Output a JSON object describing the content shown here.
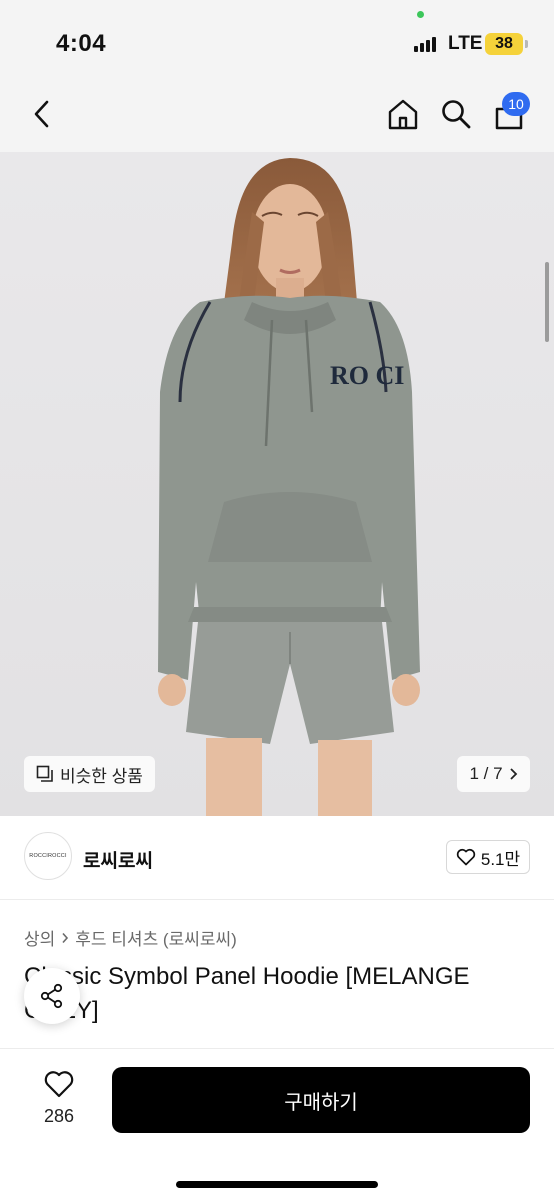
{
  "status_bar": {
    "time": "4:04",
    "network": "LTE",
    "battery": "38",
    "battery_color": "#f5d23a"
  },
  "nav": {
    "cart_count": "10",
    "badge_color": "#2f6bf0"
  },
  "hero": {
    "logo_text": "RO CI",
    "similar_label": "비슷한 상품",
    "counter": "1 / 7"
  },
  "shop": {
    "logo_text": "ROCCIROCCI",
    "name": "로씨로씨",
    "likes": "5.1만"
  },
  "product": {
    "category_1": "상의",
    "category_2": "후드 티셔츠 (로씨로씨)",
    "title": "Classic Symbol Panel Hoodie [MELANGE GREY]"
  },
  "bottom_bar": {
    "wish_count": "286",
    "buy_label": "구매하기"
  },
  "icons": [
    "back-icon",
    "home-icon",
    "search-icon",
    "cart-icon",
    "similar-icon",
    "chevron-right-icon",
    "heart-icon",
    "share-icon"
  ]
}
